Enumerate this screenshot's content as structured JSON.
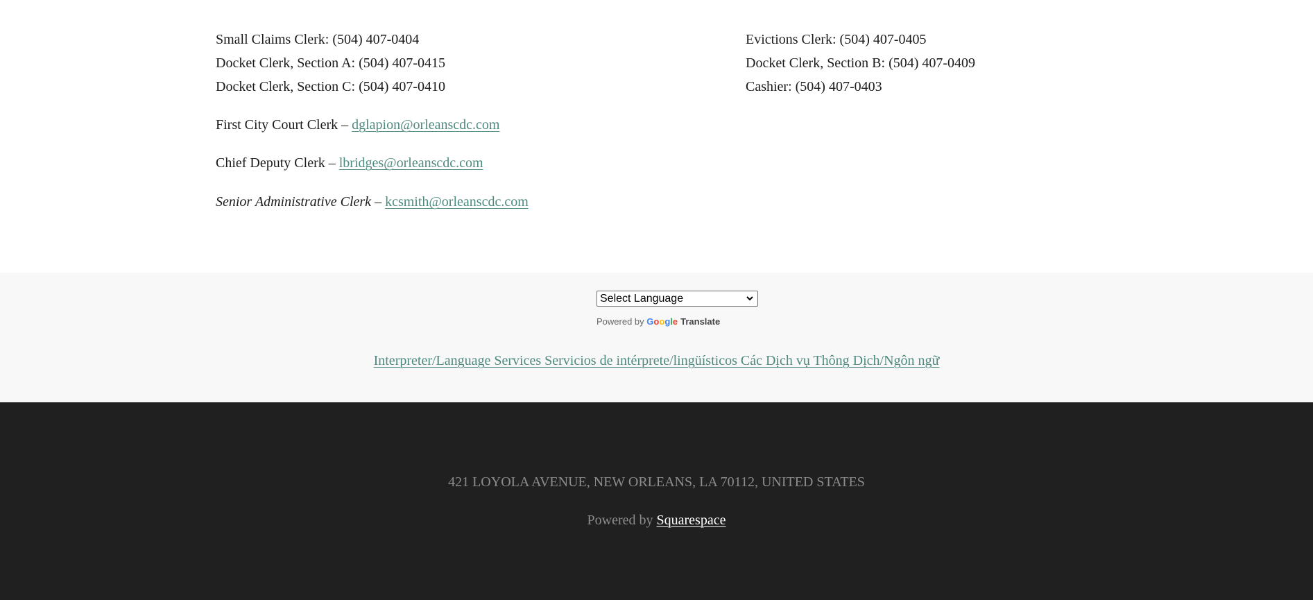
{
  "contacts": {
    "left_column": [
      "Small Claims Clerk: (504) 407-0404",
      "Docket Clerk, Section A: (504) 407-0415",
      "Docket Clerk, Section C: (504) 407-0410"
    ],
    "right_column": [
      "Evictions Clerk: (504) 407-0405",
      "Docket Clerk, Section B: (504) 407-0409",
      "Cashier: (504) 407-0403"
    ],
    "emails": [
      {
        "role": "First City Court Clerk",
        "separator": " – ",
        "email": "dglapion@orleanscdc.com",
        "italic": false
      },
      {
        "role": "Chief Deputy Clerk",
        "separator": " – ",
        "email": "lbridges@orleanscdc.com",
        "italic": false
      },
      {
        "role": "Senior Administrative Clerk",
        "separator": " – ",
        "email": "kcsmith@orleanscdc.com",
        "italic": true
      }
    ]
  },
  "translate": {
    "select_label": "Select Language",
    "powered_by": "Powered by",
    "google_letters": [
      "G",
      "o",
      "o",
      "g",
      "l",
      "e"
    ],
    "translate_word": "Translate",
    "interpreter_link": "Interpreter/Language Services Servicios de intérprete/lingüísticos Các Dịch vụ Thông Dịch/Ngôn ngữ"
  },
  "footer": {
    "address": "421  LOYOLA AVENUE, NEW ORLEANS, LA 70112, UNITED STATES",
    "powered_by": "Powered by",
    "squarespace_link": "Squarespace"
  },
  "colors": {
    "link": "#4e8a7f",
    "footer_bg": "#202020",
    "translate_band_bg": "#f9f8f8",
    "footer_text": "#8c8c8c"
  }
}
